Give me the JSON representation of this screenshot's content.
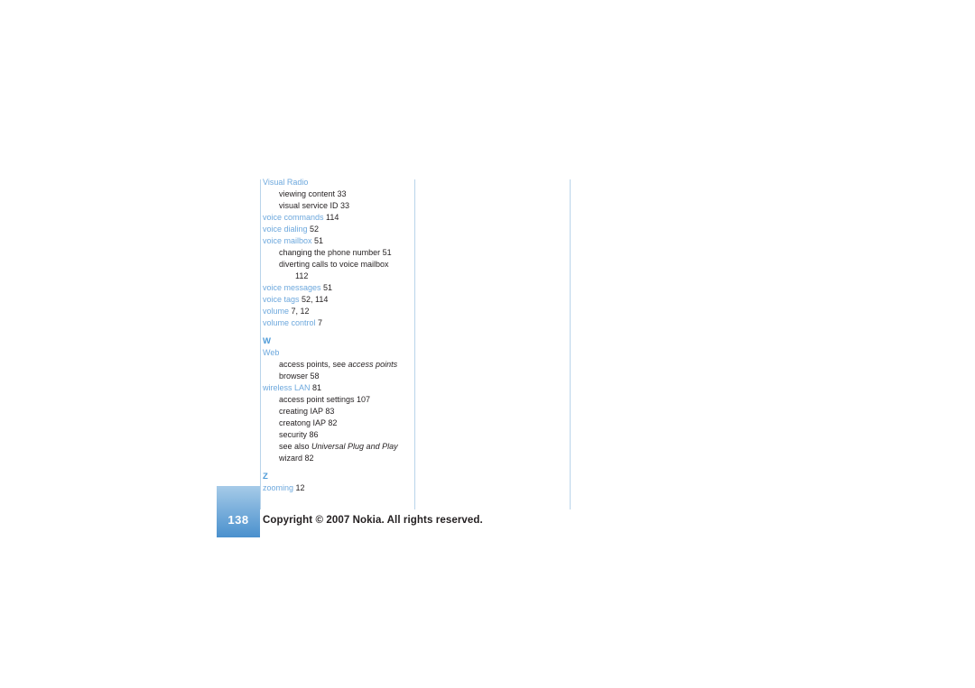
{
  "page": {
    "number": "138",
    "footer": "Copyright © 2007 Nokia. All rights reserved."
  },
  "index": {
    "entries": [
      {
        "kind": "head",
        "indent": 0,
        "term": "Visual Radio",
        "page": ""
      },
      {
        "kind": "sub",
        "indent": 1,
        "term": "viewing content",
        "page": "33"
      },
      {
        "kind": "sub",
        "indent": 1,
        "term": "visual service ID",
        "page": "33"
      },
      {
        "kind": "head",
        "indent": 0,
        "term": "voice commands",
        "page": "114"
      },
      {
        "kind": "head",
        "indent": 0,
        "term": "voice dialing",
        "page": "52"
      },
      {
        "kind": "head",
        "indent": 0,
        "term": "voice mailbox",
        "page": "51"
      },
      {
        "kind": "sub",
        "indent": 1,
        "term": "changing the phone number",
        "page": "51"
      },
      {
        "kind": "sub",
        "indent": 1,
        "term": "diverting calls to voice mailbox",
        "page": ""
      },
      {
        "kind": "sub",
        "indent": 2,
        "term": "",
        "page": "112"
      },
      {
        "kind": "head",
        "indent": 0,
        "term": "voice messages",
        "page": "51"
      },
      {
        "kind": "head",
        "indent": 0,
        "term": "voice tags",
        "page": "52, 114"
      },
      {
        "kind": "head",
        "indent": 0,
        "term": "volume",
        "page": "7, 12"
      },
      {
        "kind": "head",
        "indent": 0,
        "term": "volume control",
        "page": "7"
      },
      {
        "kind": "letter",
        "indent": 0,
        "term": "W",
        "page": ""
      },
      {
        "kind": "head",
        "indent": 0,
        "term": "Web",
        "page": ""
      },
      {
        "kind": "sub",
        "indent": 1,
        "term": "access points, see ",
        "italic": "access points",
        "page": ""
      },
      {
        "kind": "sub",
        "indent": 1,
        "term": "browser",
        "page": "58"
      },
      {
        "kind": "head",
        "indent": 0,
        "term": "wireless LAN",
        "page": "81"
      },
      {
        "kind": "sub",
        "indent": 1,
        "term": "access point settings",
        "page": "107"
      },
      {
        "kind": "sub",
        "indent": 1,
        "term": "creating IAP",
        "page": "83"
      },
      {
        "kind": "sub",
        "indent": 1,
        "term": "creatong IAP",
        "page": "82"
      },
      {
        "kind": "sub",
        "indent": 1,
        "term": "security",
        "page": "86"
      },
      {
        "kind": "sub",
        "indent": 1,
        "term": "see also ",
        "italic": "Universal Plug and Play",
        "page": ""
      },
      {
        "kind": "sub",
        "indent": 1,
        "term": "wizard",
        "page": "82"
      },
      {
        "kind": "letter",
        "indent": 0,
        "term": "Z",
        "page": ""
      },
      {
        "kind": "head",
        "indent": 0,
        "term": "zooming",
        "page": "12"
      }
    ]
  },
  "colors": {
    "accent": "#6da8dd",
    "letter": "#4e9bd8",
    "rule": "#b9d4ea",
    "text": "#231f20",
    "tab_top": "#a6cbe8",
    "tab_bottom": "#4a90cd"
  }
}
